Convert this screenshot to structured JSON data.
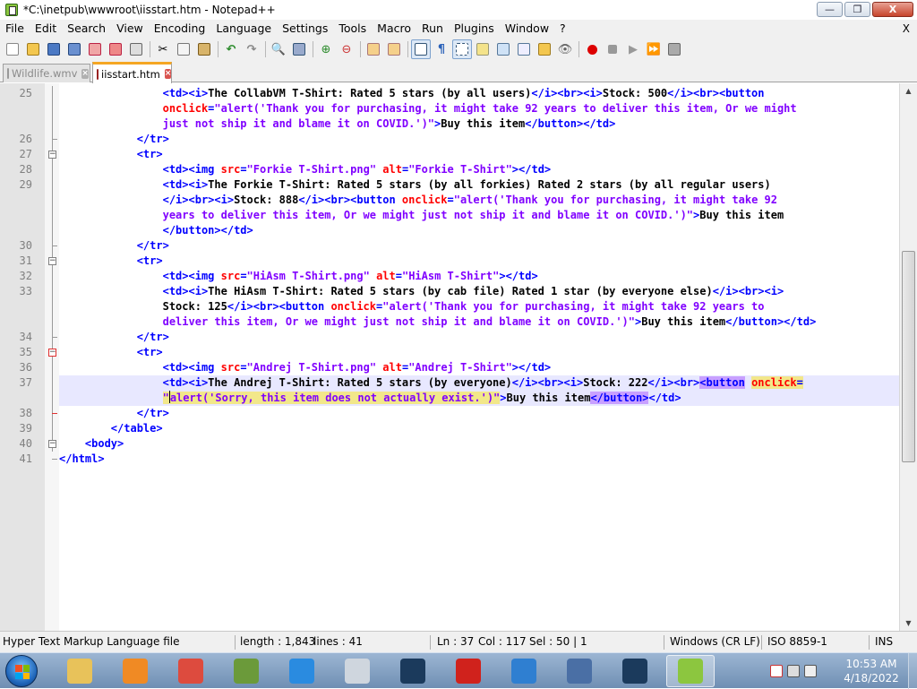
{
  "window": {
    "title": "*C:\\inetpub\\wwwroot\\iisstart.htm - Notepad++",
    "controls": {
      "minimize": "—",
      "maximize": "❐",
      "close": "X"
    }
  },
  "menu": {
    "items": [
      "File",
      "Edit",
      "Search",
      "View",
      "Encoding",
      "Language",
      "Settings",
      "Tools",
      "Macro",
      "Run",
      "Plugins",
      "Window",
      "?"
    ],
    "close": "X"
  },
  "toolbar": {
    "buttons": [
      "new-file-icon",
      "open-file-icon",
      "save-icon",
      "save-all-icon",
      "close-icon",
      "close-all-icon",
      "print-icon",
      "cut-icon",
      "copy-icon",
      "paste-icon",
      "undo-icon",
      "redo-icon",
      "find-icon",
      "replace-icon",
      "zoom-in-icon",
      "zoom-out-icon",
      "sync-vertical-icon",
      "sync-horizontal-icon",
      "word-wrap-icon",
      "show-all-characters-icon",
      "indent-guide-icon",
      "language-icon",
      "document-map-icon",
      "function-list-icon",
      "folder-workspace-icon",
      "monitoring-icon",
      "record-macro-icon",
      "stop-macro-icon",
      "play-macro-icon",
      "run-macro-multiple-icon",
      "save-macro-icon"
    ]
  },
  "tabs": [
    {
      "label": "Wildlife.wmv",
      "active": false
    },
    {
      "label": "iisstart.htm",
      "active": true
    }
  ],
  "editor": {
    "lines": [
      {
        "num": "25",
        "row": 0,
        "fold": "",
        "segments": [
          [
            "tx",
            "                "
          ],
          [
            "tg",
            "<td><i>"
          ],
          [
            "tx",
            "The CollabVM T-Shirt: Rated 5 stars (by all users)"
          ],
          [
            "tg",
            "</i><br><i>"
          ],
          [
            "tx",
            "Stock: 500"
          ],
          [
            "tg",
            "</i><br><button"
          ]
        ]
      },
      {
        "num": "",
        "row": 1,
        "fold": "",
        "segments": [
          [
            "tx",
            "                "
          ],
          [
            "at",
            "onclick"
          ],
          [
            "tg",
            "="
          ],
          [
            "st",
            "\"alert('Thank you for purchasing, it might take 92 years to deliver this item, Or we might"
          ]
        ]
      },
      {
        "num": "",
        "row": 2,
        "fold": "",
        "segments": [
          [
            "tx",
            "                "
          ],
          [
            "st",
            "just not ship it and blame it on COVID.')\""
          ],
          [
            "tg",
            ">"
          ],
          [
            "tx",
            "Buy this item"
          ],
          [
            "tg",
            "</button></td>"
          ]
        ]
      },
      {
        "num": "26",
        "row": 3,
        "fold": "end",
        "segments": [
          [
            "tx",
            "            "
          ],
          [
            "tg",
            "</tr>"
          ]
        ]
      },
      {
        "num": "27",
        "row": 4,
        "fold": "box",
        "segments": [
          [
            "tx",
            "            "
          ],
          [
            "tg",
            "<tr>"
          ]
        ]
      },
      {
        "num": "28",
        "row": 5,
        "fold": "",
        "segments": [
          [
            "tx",
            "                "
          ],
          [
            "tg",
            "<td><img "
          ],
          [
            "at",
            "src"
          ],
          [
            "tg",
            "="
          ],
          [
            "st",
            "\"Forkie T-Shirt.png\""
          ],
          [
            "tg",
            " "
          ],
          [
            "at",
            "alt"
          ],
          [
            "tg",
            "="
          ],
          [
            "st",
            "\"Forkie T-Shirt\""
          ],
          [
            "tg",
            "></td>"
          ]
        ]
      },
      {
        "num": "29",
        "row": 6,
        "fold": "",
        "segments": [
          [
            "tx",
            "                "
          ],
          [
            "tg",
            "<td><i>"
          ],
          [
            "tx",
            "The Forkie T-Shirt: Rated 5 stars (by all forkies) Rated 2 stars (by all regular users)"
          ]
        ]
      },
      {
        "num": "",
        "row": 7,
        "fold": "",
        "segments": [
          [
            "tx",
            "                "
          ],
          [
            "tg",
            "</i><br><i>"
          ],
          [
            "tx",
            "Stock: 888"
          ],
          [
            "tg",
            "</i><br><button "
          ],
          [
            "at",
            "onclick"
          ],
          [
            "tg",
            "="
          ],
          [
            "st",
            "\"alert('Thank you for purchasing, it might take 92"
          ]
        ]
      },
      {
        "num": "",
        "row": 8,
        "fold": "",
        "segments": [
          [
            "tx",
            "                "
          ],
          [
            "st",
            "years to deliver this item, Or we might just not ship it and blame it on COVID.')\""
          ],
          [
            "tg",
            ">"
          ],
          [
            "tx",
            "Buy this item"
          ]
        ]
      },
      {
        "num": "",
        "row": 9,
        "fold": "",
        "segments": [
          [
            "tx",
            "                "
          ],
          [
            "tg",
            "</button></td>"
          ]
        ]
      },
      {
        "num": "30",
        "row": 10,
        "fold": "end",
        "segments": [
          [
            "tx",
            "            "
          ],
          [
            "tg",
            "</tr>"
          ]
        ]
      },
      {
        "num": "31",
        "row": 11,
        "fold": "box",
        "segments": [
          [
            "tx",
            "            "
          ],
          [
            "tg",
            "<tr>"
          ]
        ]
      },
      {
        "num": "32",
        "row": 12,
        "fold": "",
        "segments": [
          [
            "tx",
            "                "
          ],
          [
            "tg",
            "<td><img "
          ],
          [
            "at",
            "src"
          ],
          [
            "tg",
            "="
          ],
          [
            "st",
            "\"HiAsm T-Shirt.png\""
          ],
          [
            "tg",
            " "
          ],
          [
            "at",
            "alt"
          ],
          [
            "tg",
            "="
          ],
          [
            "st",
            "\"HiAsm T-Shirt\""
          ],
          [
            "tg",
            "></td>"
          ]
        ]
      },
      {
        "num": "33",
        "row": 13,
        "fold": "",
        "segments": [
          [
            "tx",
            "                "
          ],
          [
            "tg",
            "<td><i>"
          ],
          [
            "tx",
            "The HiAsm T-Shirt: Rated 5 stars (by cab file) Rated 1 star (by everyone else)"
          ],
          [
            "tg",
            "</i><br><i>"
          ]
        ]
      },
      {
        "num": "",
        "row": 14,
        "fold": "",
        "segments": [
          [
            "tx",
            "                "
          ],
          [
            "tx",
            "Stock: 125"
          ],
          [
            "tg",
            "</i><br><button "
          ],
          [
            "at",
            "onclick"
          ],
          [
            "tg",
            "="
          ],
          [
            "st",
            "\"alert('Thank you for purchasing, it might take 92 years to"
          ]
        ]
      },
      {
        "num": "",
        "row": 15,
        "fold": "",
        "segments": [
          [
            "tx",
            "                "
          ],
          [
            "st",
            "deliver this item, Or we might just not ship it and blame it on COVID.')\""
          ],
          [
            "tg",
            ">"
          ],
          [
            "tx",
            "Buy this item"
          ],
          [
            "tg",
            "</button></td>"
          ]
        ]
      },
      {
        "num": "34",
        "row": 16,
        "fold": "end",
        "segments": [
          [
            "tx",
            "            "
          ],
          [
            "tg",
            "</tr>"
          ]
        ]
      },
      {
        "num": "35",
        "row": 17,
        "fold": "boxred",
        "segments": [
          [
            "tx",
            "            "
          ],
          [
            "tg",
            "<tr>"
          ]
        ]
      },
      {
        "num": "36",
        "row": 18,
        "fold": "",
        "segments": [
          [
            "tx",
            "                "
          ],
          [
            "tg",
            "<td><img "
          ],
          [
            "at",
            "src"
          ],
          [
            "tg",
            "="
          ],
          [
            "st",
            "\"Andrej T-Shirt.png\""
          ],
          [
            "tg",
            " "
          ],
          [
            "at",
            "alt"
          ],
          [
            "tg",
            "="
          ],
          [
            "st",
            "\"Andrej T-Shirt\""
          ],
          [
            "tg",
            "></td>"
          ]
        ]
      },
      {
        "num": "37",
        "row": 19,
        "fold": "",
        "current": true,
        "segments": [
          [
            "tx",
            "                "
          ],
          [
            "tg",
            "<td><i>"
          ],
          [
            "tx",
            "The Andrej T-Shirt: Rated 5 stars (by everyone)"
          ],
          [
            "tg",
            "</i><br><i>"
          ],
          [
            "tx",
            "Stock: 222"
          ],
          [
            "tg",
            "</i><br>"
          ],
          [
            "tg hlb",
            "<button"
          ],
          [
            "tg",
            " "
          ],
          [
            "at hly",
            "onclick"
          ],
          [
            "tg hly",
            "="
          ]
        ]
      },
      {
        "num": "",
        "row": 20,
        "fold": "",
        "current": true,
        "segments": [
          [
            "tx",
            "                "
          ],
          [
            "st hly",
            "\""
          ],
          [
            "caret",
            ""
          ],
          [
            "st hly",
            "alert('Sorry, this item does not actually exist.')\""
          ],
          [
            "tg",
            ">"
          ],
          [
            "tx",
            "Buy this item"
          ],
          [
            "tg hlb",
            "</button>"
          ],
          [
            "tg",
            "</td>"
          ]
        ]
      },
      {
        "num": "38",
        "row": 21,
        "fold": "endred",
        "segments": [
          [
            "tx",
            "            "
          ],
          [
            "tg",
            "</tr>"
          ]
        ]
      },
      {
        "num": "39",
        "row": 22,
        "fold": "",
        "segments": [
          [
            "tx",
            "        "
          ],
          [
            "tg",
            "</table>"
          ]
        ]
      },
      {
        "num": "40",
        "row": 23,
        "fold": "box",
        "segments": [
          [
            "tx",
            "    "
          ],
          [
            "tg",
            "<body>"
          ]
        ]
      },
      {
        "num": "41",
        "row": 24,
        "fold": "endlast",
        "segments": [
          [
            "tg",
            "</html>"
          ]
        ]
      }
    ]
  },
  "status": {
    "file_type": "Hyper Text Markup Language file",
    "length": "length : 1,843",
    "lines": "lines : 41",
    "ln": "Ln : 37",
    "col": "Col : 117",
    "sel": "Sel : 50 | 1",
    "eol": "Windows (CR LF)",
    "encoding": "ISO 8859-1",
    "mode": "INS"
  },
  "taskbar": {
    "apps": [
      {
        "name": "explorer-icon",
        "color": "#e8c25a"
      },
      {
        "name": "media-player-icon",
        "color": "#f08a24"
      },
      {
        "name": "chrome-icon",
        "color": "#dd4b3e"
      },
      {
        "name": "minecraft-icon",
        "color": "#6b9a3a"
      },
      {
        "name": "roblox-icon",
        "color": "#2a8be0"
      },
      {
        "name": "roblox-studio-icon",
        "color": "#cfd6de"
      },
      {
        "name": "steam-icon",
        "color": "#1b3a5c"
      },
      {
        "name": "d-app-icon",
        "color": "#d0221c"
      },
      {
        "name": "globe-d-app-icon",
        "color": "#2f7fd1"
      },
      {
        "name": "display-settings-icon",
        "color": "#4a6fa5"
      },
      {
        "name": "steam-icon-2",
        "color": "#1b3a5c"
      },
      {
        "name": "notepad-plus-plus-icon",
        "color": "#8cc63f"
      }
    ],
    "clock_time": "10:53 AM",
    "clock_date": "4/18/2022"
  }
}
